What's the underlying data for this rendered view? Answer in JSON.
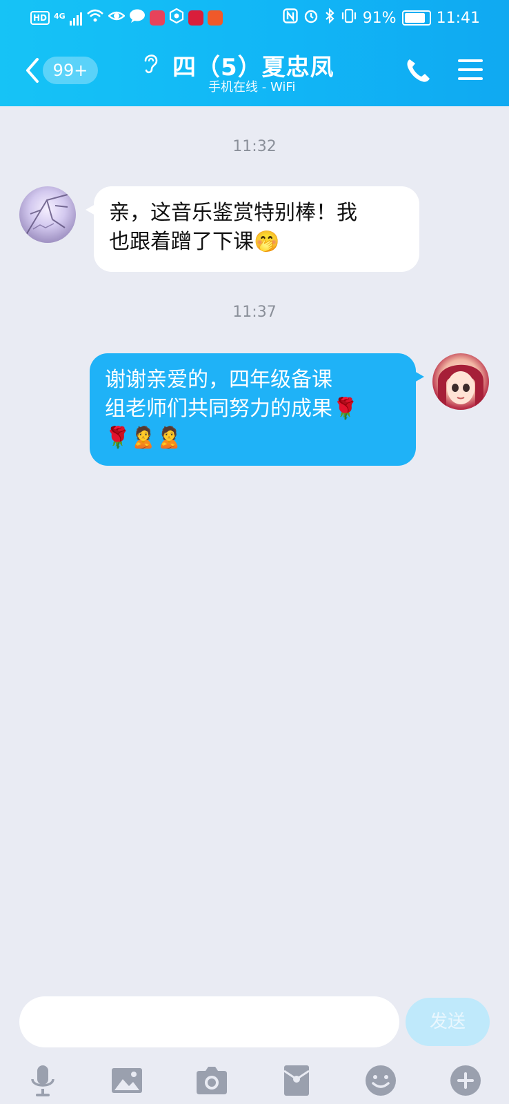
{
  "status_bar": {
    "network": "4G",
    "battery": "91%",
    "time": "11:41"
  },
  "header": {
    "back_badge": "99+",
    "title": "四（5）夏忠凤",
    "subtitle": "手机在线 - WiFi"
  },
  "messages": [
    {
      "time": "11:32",
      "side": "left",
      "text": "亲，这音乐鉴赏特别棒！我\n也跟着蹭了下课🤭"
    },
    {
      "time": "11:37",
      "side": "right",
      "text": "谢谢亲爱的，四年级备课\n组老师们共同努力的成果🌹\n🌹🙎🙎"
    }
  ],
  "input": {
    "placeholder": "",
    "send_label": "发送"
  },
  "toolbar": {
    "icons": [
      "microphone-icon",
      "image-icon",
      "camera-icon",
      "red-envelope-icon",
      "emoji-icon",
      "plus-icon"
    ]
  },
  "colors": {
    "header_blue": "#11b6f6",
    "bubble_blue": "#1fb2f7",
    "background": "#e9ebf3",
    "icon_gray": "#9aa0ae"
  }
}
